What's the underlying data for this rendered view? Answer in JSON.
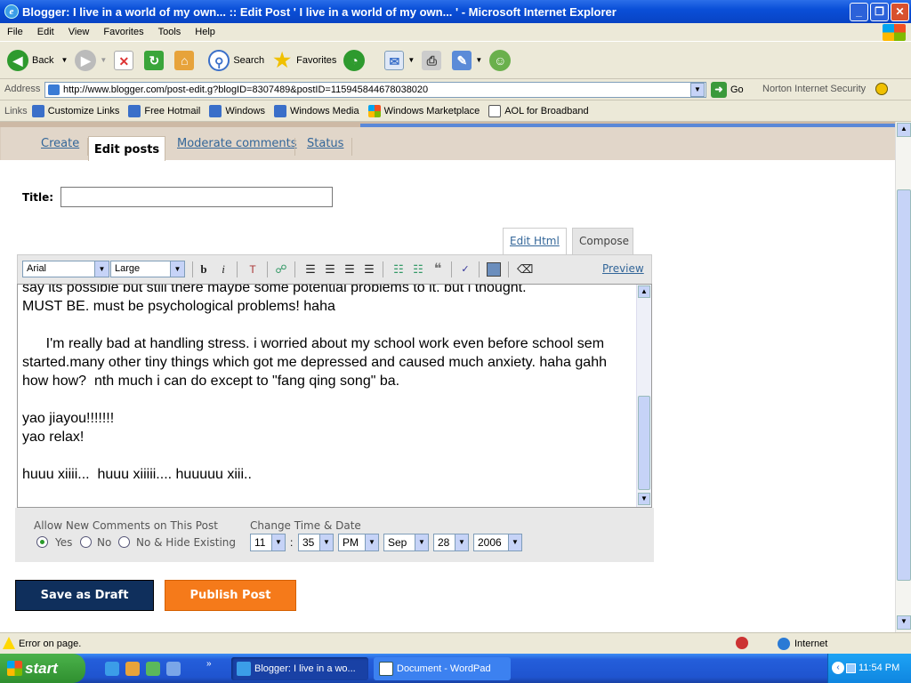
{
  "window": {
    "title": "Blogger: I live in a world of my own... :: Edit Post ' I live in a world of my own... ' - Microsoft Internet Explorer",
    "controls": [
      "_",
      "❐",
      "✕"
    ]
  },
  "menu": [
    "File",
    "Edit",
    "View",
    "Favorites",
    "Tools",
    "Help"
  ],
  "toolbar": {
    "back": "Back",
    "search": "Search",
    "favorites": "Favorites"
  },
  "address": {
    "label": "Address",
    "url": "http://www.blogger.com/post-edit.g?blogID=8307489&postID=115945844678038020",
    "go": "Go",
    "norton": "Norton Internet Security"
  },
  "links": {
    "label": "Links",
    "items": [
      "Customize Links",
      "Free Hotmail",
      "Windows",
      "Windows Media",
      "Windows Marketplace",
      "AOL for Broadband"
    ]
  },
  "blogger": {
    "tabs": [
      "Create",
      "Edit posts",
      "Moderate comments",
      "Status"
    ],
    "title_label": "Title:",
    "title_value": "",
    "mode_tabs": {
      "edit_html": "Edit Html",
      "compose": "Compose"
    },
    "font": "Arial",
    "size": "Large",
    "preview": "Preview",
    "body": "say its possible but still there maybe some potential problems to it. but i thought.\nMUST BE. must be psychological problems! haha\n\n      I'm really bad at handling stress. i worried about my school work even before school sem started.many other tiny things which got me depressed and caused much anxiety. haha gahh\nhow how?  nth much i can do except to \"fang qing song\" ba.\n\nyao jiayou!!!!!!!\nyao relax!\n\nhuuu xiiii...  huuu xiiiii.... huuuuu xiii..",
    "comments": {
      "label": "Allow New Comments on This Post",
      "options": [
        "Yes",
        "No",
        "No & Hide Existing"
      ],
      "selected": "Yes"
    },
    "datetime": {
      "label": "Change Time & Date",
      "hour": "11",
      "minute": "35",
      "ampm": "PM",
      "month": "Sep",
      "day": "28",
      "year": "2006"
    },
    "save_draft": "Save as Draft",
    "publish": "Publish Post"
  },
  "status": {
    "text": "Error on page.",
    "zone": "Internet"
  },
  "taskbar": {
    "start": "start",
    "tasks": [
      "Blogger: I live in a wo...",
      "Document - WordPad"
    ],
    "clock": "11:54 PM"
  }
}
